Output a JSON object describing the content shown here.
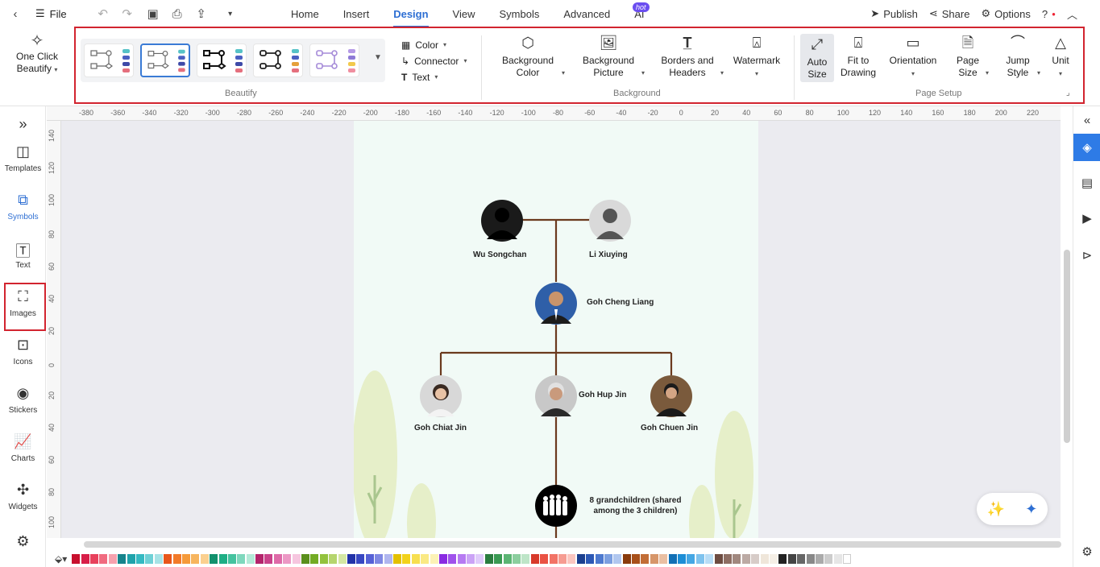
{
  "menu": {
    "file": "File",
    "tabs": [
      "Home",
      "Insert",
      "Design",
      "View",
      "Symbols",
      "Advanced",
      "AI"
    ],
    "active_tab": "Design",
    "hot_badge": "hot",
    "publish": "Publish",
    "share": "Share",
    "options": "Options"
  },
  "ribbon": {
    "one_click": "One Click Beautify",
    "color": "Color",
    "connector": "Connector",
    "text": "Text",
    "beautify_label": "Beautify",
    "bg_color": "Background Color",
    "bg_picture": "Background Picture",
    "borders": "Borders and Headers",
    "watermark": "Watermark",
    "background_label": "Background",
    "auto_size": "Auto Size",
    "fit_drawing": "Fit to Drawing",
    "orientation": "Orientation",
    "page_size": "Page Size",
    "jump_style": "Jump Style",
    "unit": "Unit",
    "page_setup_label": "Page Setup"
  },
  "left_panel": {
    "items": [
      {
        "label": "Templates",
        "icon": "templates-icon"
      },
      {
        "label": "Symbols",
        "icon": "symbols-icon"
      },
      {
        "label": "Text",
        "icon": "text-icon"
      },
      {
        "label": "Images",
        "icon": "images-icon"
      },
      {
        "label": "Icons",
        "icon": "icons-icon"
      },
      {
        "label": "Stickers",
        "icon": "stickers-icon"
      },
      {
        "label": "Charts",
        "icon": "charts-icon"
      },
      {
        "label": "Widgets",
        "icon": "widgets-icon"
      }
    ],
    "active": "Symbols"
  },
  "ruler_h": [
    "-380",
    "-360",
    "-340",
    "-320",
    "-300",
    "-280",
    "-260",
    "-240",
    "-220",
    "-200",
    "-180",
    "-160",
    "-140",
    "-120",
    "-100",
    "-80",
    "-60",
    "-40",
    "-20",
    "0",
    "20",
    "40",
    "60",
    "80",
    "100",
    "120",
    "140",
    "160",
    "180",
    "200",
    "220"
  ],
  "ruler_v": [
    "140",
    "120",
    "100",
    "80",
    "60",
    "40",
    "20",
    "0",
    "20",
    "40",
    "60",
    "80",
    "100"
  ],
  "tree": {
    "grandfather": "Wu Songchan",
    "grandmother": "Li Xiuying",
    "father": "Goh Cheng Liang",
    "child_left": "Goh Chiat Jin",
    "child_mid": "Goh Hup Jin",
    "child_right": "Goh Chuen Jin",
    "grandchildren": "8 grandchildren (shared among the 3 children)"
  },
  "colors": {
    "accent": "#2e6fd3",
    "highlight": "#d2242f",
    "connector": "#6b3a1e",
    "page_bg": "#f1faf6",
    "palette": [
      "#c8102e",
      "#d81e48",
      "#e8415c",
      "#f06b80",
      "#f7a1ae",
      "#16848c",
      "#1fa3ab",
      "#35bac2",
      "#6fd1d6",
      "#a7e3e6",
      "#e8561a",
      "#f27a29",
      "#f59a3a",
      "#f7b55e",
      "#fbd08f",
      "#12916d",
      "#1eae85",
      "#45c39f",
      "#7fd8bd",
      "#b4ead8",
      "#b3246b",
      "#c9428a",
      "#de6aa8",
      "#ec98c5",
      "#f6c6df",
      "#5a8f1c",
      "#73ab24",
      "#93c23d",
      "#b5d56e",
      "#d4e7a3",
      "#2232a8",
      "#3847c2",
      "#5661d6",
      "#7f88e3",
      "#b0b6ef",
      "#e3c000",
      "#f2d21a",
      "#f7df4f",
      "#fae984",
      "#fcf2b6",
      "#8a2be2",
      "#a052ec",
      "#b67af2",
      "#cba3f6",
      "#e0cbfb",
      "#2a7d3f",
      "#3a9a53",
      "#5cb574",
      "#8cce9e",
      "#bee5c8",
      "#d83a2b",
      "#ea5244",
      "#f27366",
      "#f69c92",
      "#fbc6c0",
      "#1b3f8f",
      "#2c58b5",
      "#4d79cf",
      "#7c9fe0",
      "#b1c7ef",
      "#8a3b0c",
      "#a8501a",
      "#c26d36",
      "#d7966a",
      "#eabfa2",
      "#1270b5",
      "#1d8ed6",
      "#45a7e4",
      "#7fc3ee",
      "#b8ddf6",
      "#6d4c41",
      "#8d6e63",
      "#a1887f",
      "#bcaaa4",
      "#d7ccc8",
      "#efe6da",
      "#f5efe6",
      "#222222",
      "#444444",
      "#666666",
      "#888888",
      "#aaaaaa",
      "#cccccc",
      "#e6e6e6",
      "#ffffff"
    ]
  }
}
